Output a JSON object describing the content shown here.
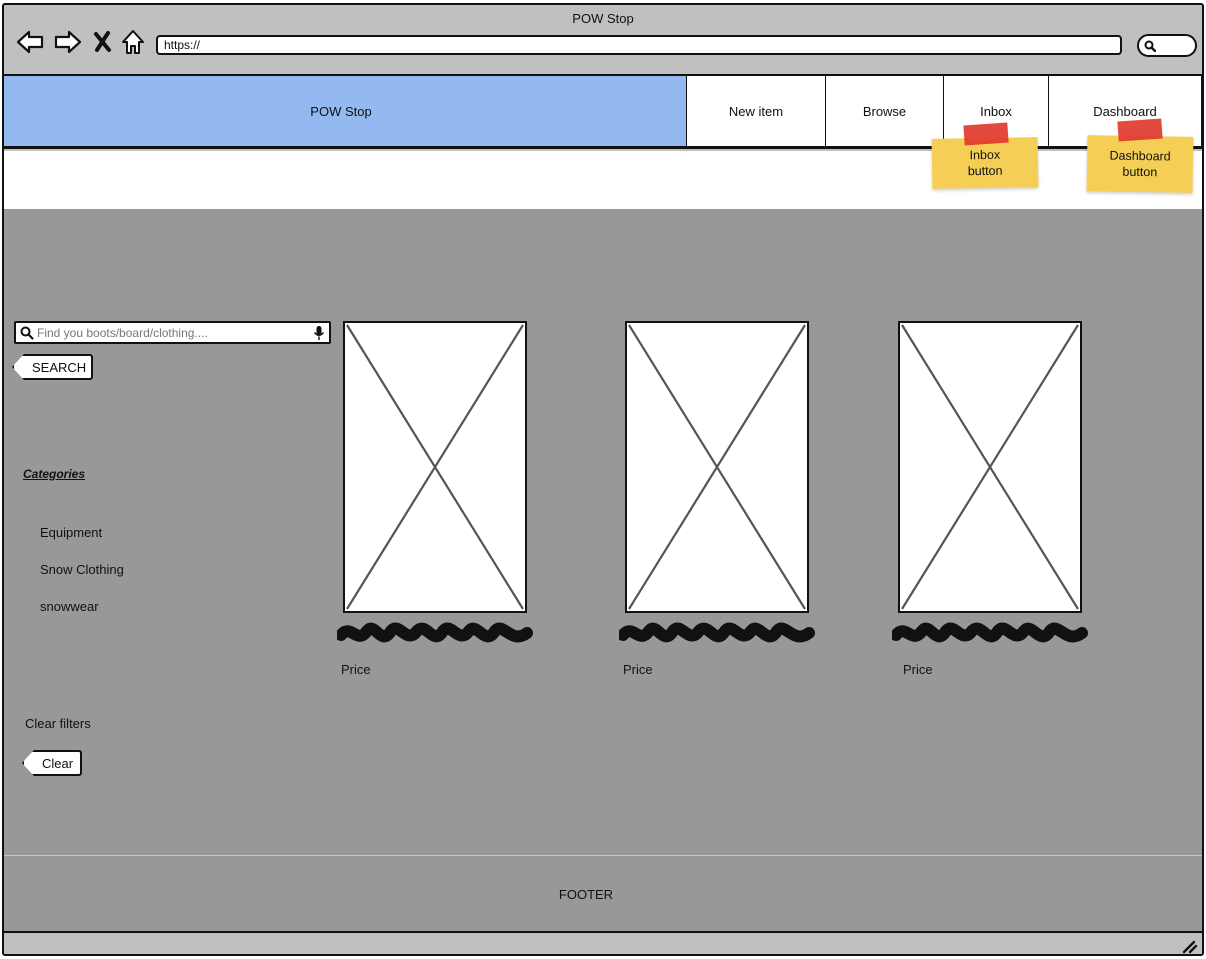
{
  "browser": {
    "title": "POW Stop",
    "url": "https://"
  },
  "header": {
    "brand": "POW Stop",
    "nav": [
      {
        "label": "New item"
      },
      {
        "label": "Browse"
      },
      {
        "label": "Inbox"
      },
      {
        "label": "Dashboard"
      }
    ]
  },
  "sidebar": {
    "search_placeholder": "Find you boots/board/clothing....",
    "search_button": "SEARCH",
    "categories_title": "Categories",
    "categories": [
      {
        "label": "Equipment"
      },
      {
        "label": "Snow Clothing"
      },
      {
        "label": "snowwear"
      }
    ],
    "clear_label": "Clear filters",
    "clear_button": "Clear"
  },
  "products": [
    {
      "price_label": "Price"
    },
    {
      "price_label": "Price"
    },
    {
      "price_label": "Price"
    }
  ],
  "footer": {
    "text": "FOOTER"
  },
  "annotations": [
    {
      "text_line1": "Inbox",
      "text_line2": "button"
    },
    {
      "text_line1": "Dashboard",
      "text_line2": "button"
    }
  ],
  "colors": {
    "brand_bg": "#93b9f0",
    "content_bg": "#989898",
    "chrome_bg": "#c0c0c0",
    "sticky_note": "#f5cf55",
    "tape": "#e03a2f"
  },
  "icons": [
    "back-arrow-icon",
    "forward-arrow-icon",
    "close-x-icon",
    "home-icon",
    "search-icon",
    "microphone-icon",
    "placeholder-image-icon",
    "resize-grip-icon"
  ]
}
